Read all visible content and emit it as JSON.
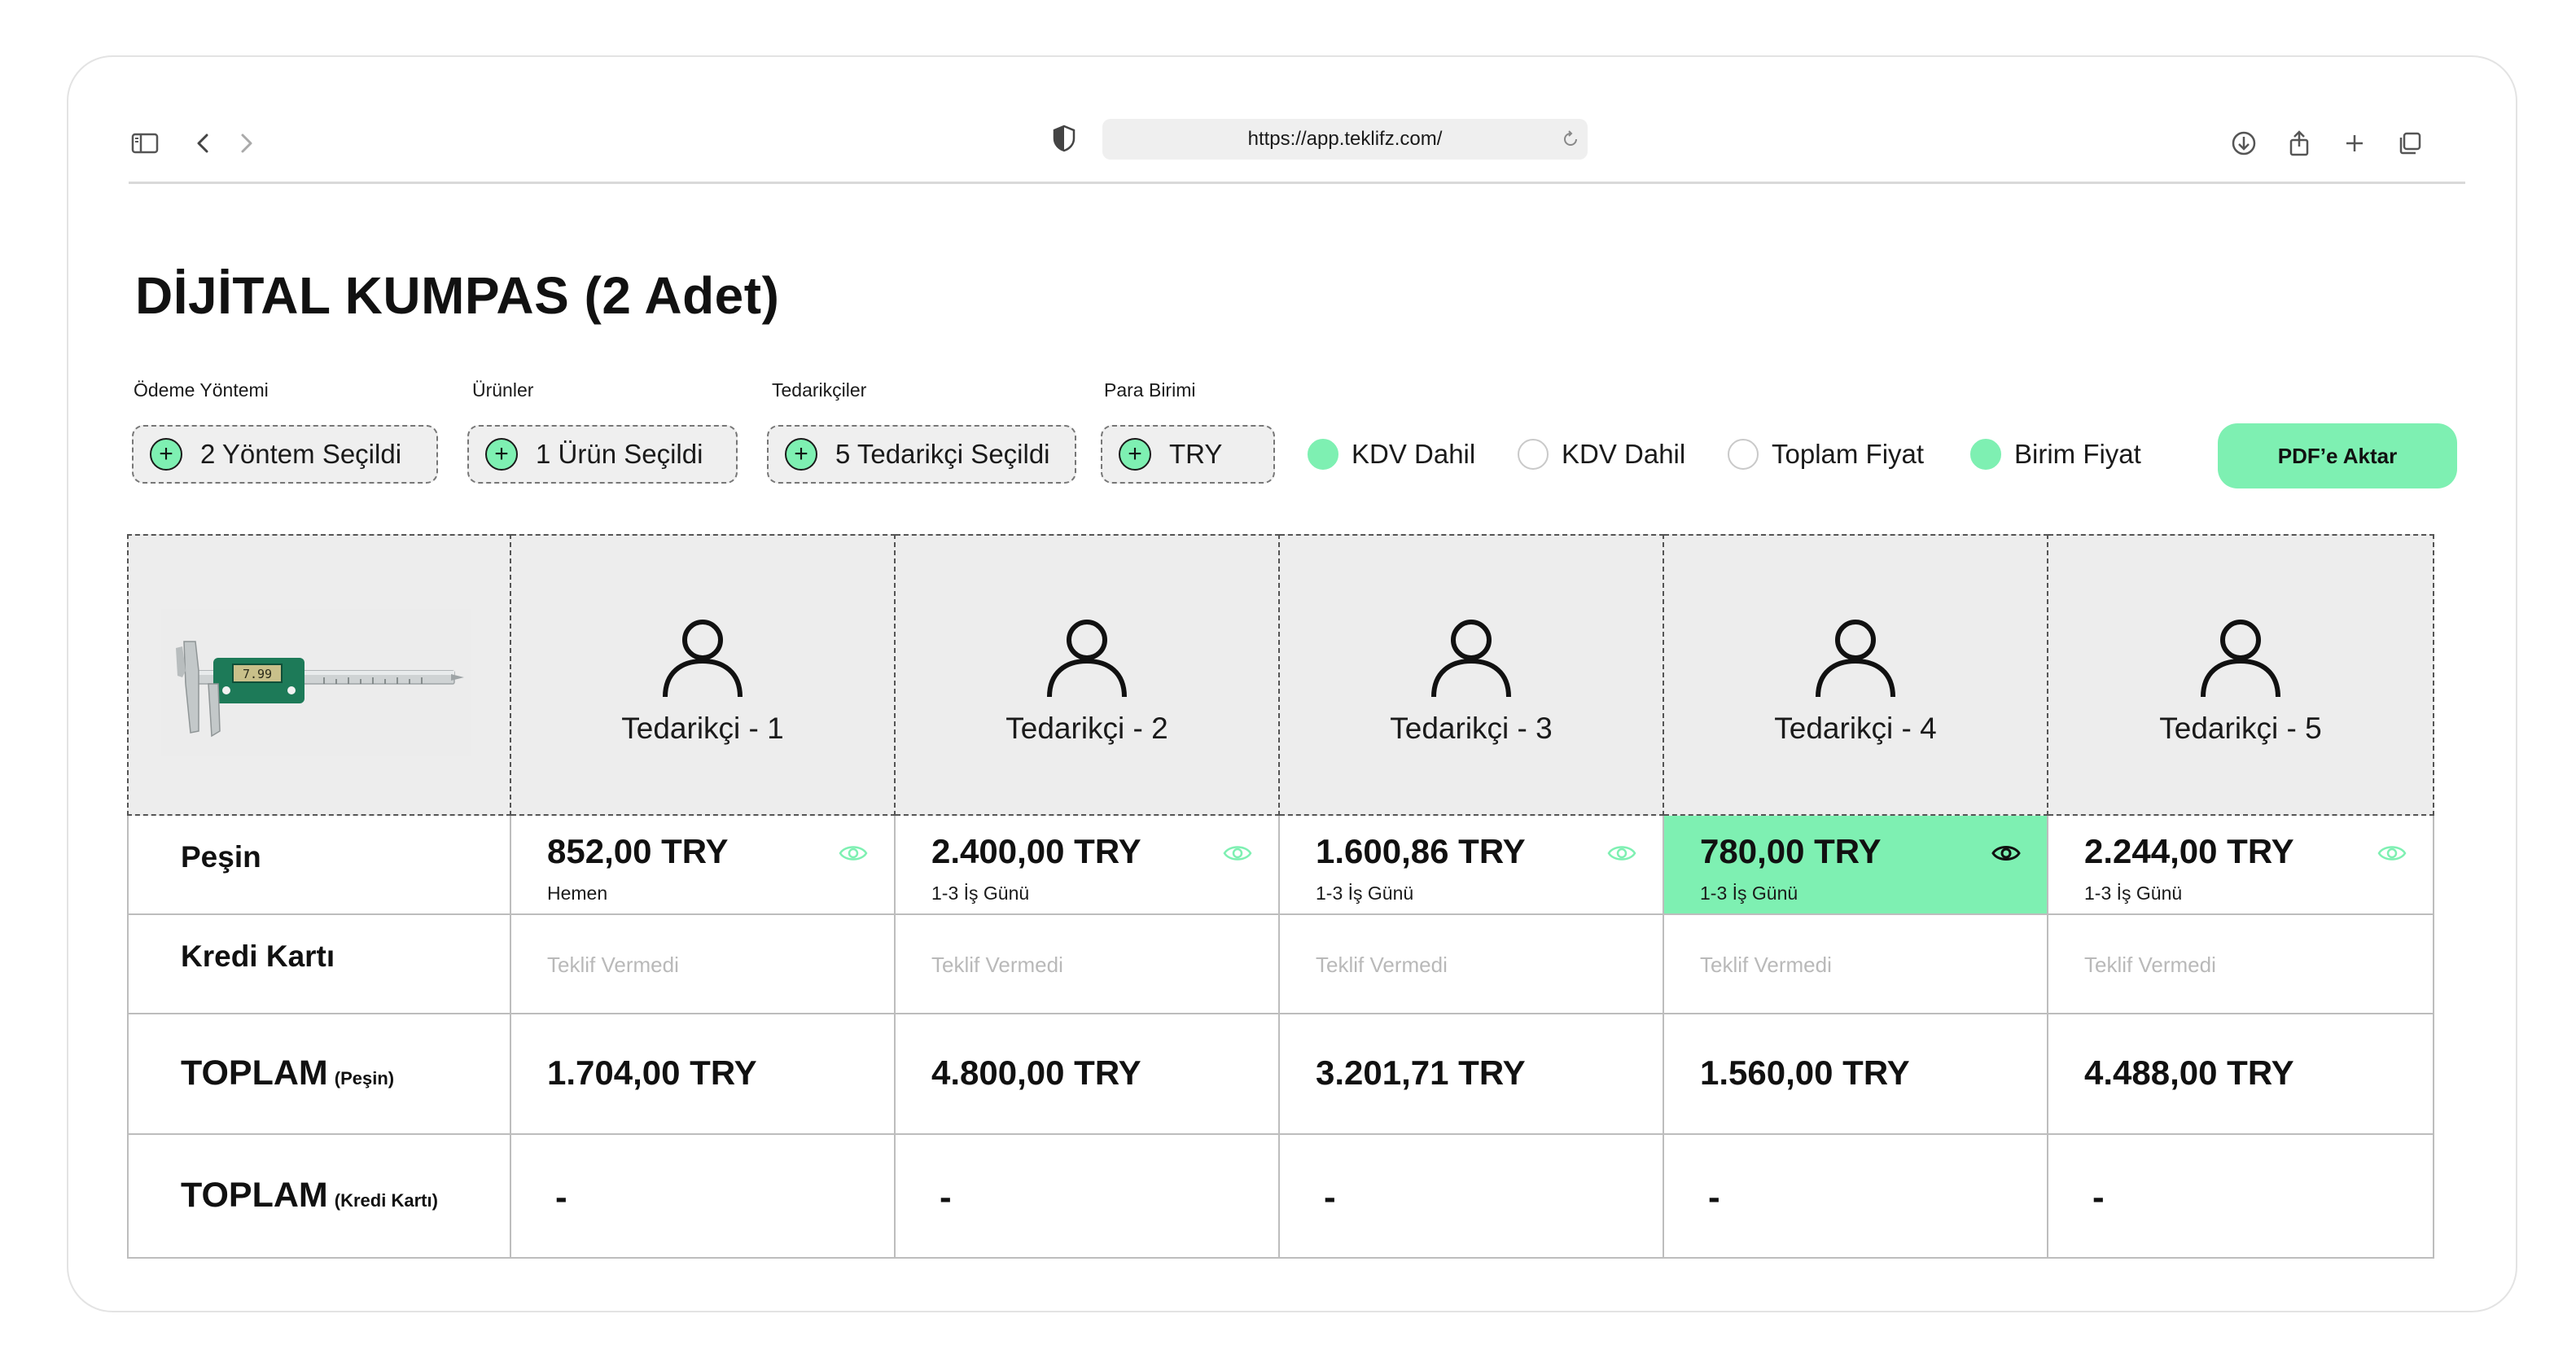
{
  "browser": {
    "url": "https://app.teklifz.com/"
  },
  "page": {
    "title": "DİJİTAL KUMPAS (2 Adet)"
  },
  "filters": {
    "payment": {
      "label": "Ödeme Yöntemi",
      "value": "2 Yöntem Seçildi"
    },
    "products": {
      "label": "Ürünler",
      "value": "1 Ürün Seçildi"
    },
    "suppliers": {
      "label": "Tedarikçiler",
      "value": "5 Tedarikçi Seçildi"
    },
    "currency": {
      "label": "Para Birimi",
      "value": "TRY"
    },
    "toggles": [
      {
        "label": "KDV Dahil",
        "on": true
      },
      {
        "label": "KDV Dahil",
        "on": false
      },
      {
        "label": "Toplam Fiyat",
        "on": false
      },
      {
        "label": "Birim Fiyat",
        "on": true
      }
    ],
    "export_label": "PDF’e Aktar"
  },
  "table": {
    "suppliers": [
      "Tedarikçi - 1",
      "Tedarikçi - 2",
      "Tedarikçi - 3",
      "Tedarikçi - 4",
      "Tedarikçi - 5"
    ],
    "rows": {
      "cash": {
        "label": "Peşin",
        "prices": [
          "852,00 TRY",
          "2.400,00 TRY",
          "1.600,86 TRY",
          "780,00 TRY",
          "2.244,00 TRY"
        ],
        "delivery": [
          "Hemen",
          "1-3 İş Günü",
          "1-3 İş Günü",
          "1-3 İş Günü",
          "1-3 İş Günü"
        ],
        "best_index": 3
      },
      "credit": {
        "label": "Kredi Kartı",
        "values": [
          "Teklif Vermedi",
          "Teklif Vermedi",
          "Teklif Vermedi",
          "Teklif Vermedi",
          "Teklif Vermedi"
        ]
      },
      "total_cash": {
        "label": "TOPLAM",
        "suffix": "(Peşin)",
        "values": [
          "1.704,00 TRY",
          "4.800,00 TRY",
          "3.201,71 TRY",
          "1.560,00 TRY",
          "4.488,00 TRY"
        ]
      },
      "total_credit": {
        "label": "TOPLAM",
        "suffix": "(Kredi Kartı)",
        "values": [
          "-",
          "-",
          "-",
          "-",
          "-"
        ]
      }
    }
  },
  "colors": {
    "accent": "#7ef0b2",
    "header_bg": "#ededed",
    "muted_text": "#b9b9b9"
  }
}
